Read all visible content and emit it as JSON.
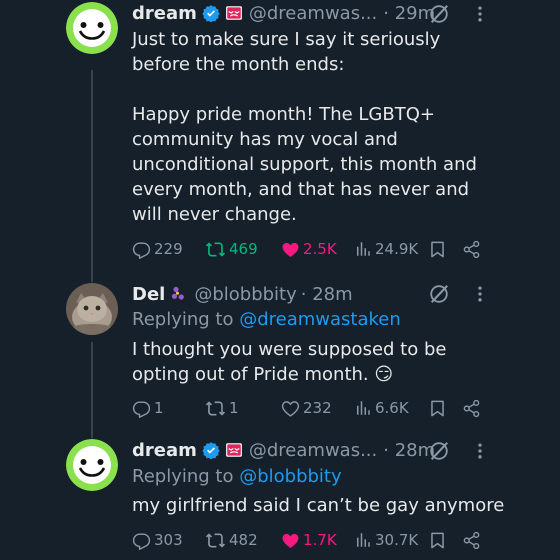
{
  "colors": {
    "background": "#15202b",
    "text": "#e7e9ea",
    "muted": "#8b98a5",
    "link": "#1d9bf0",
    "retweet": "#00ba7c",
    "like": "#f91880",
    "avatar_green": "#8be04e"
  },
  "tweets": [
    {
      "name": "dream",
      "handle": "@dreamwas...",
      "time": "· 29m",
      "text": "Just to make sure I say it seriously before the month ends:\n\nHappy pride month! The LGBTQ+ community has my vocal and unconditional support, this month and every month, and that has never and will never change.",
      "replies": "229",
      "retweets": "469",
      "likes": "2.5K",
      "views": "24.9K"
    },
    {
      "name": "Del",
      "handle": "@blobbbity",
      "time": "· 28m",
      "replying_prefix": "Replying to ",
      "replying_mention": "@dreamwastaken",
      "text": "I thought you were supposed to be opting out of Pride month. 😏",
      "replies": "1",
      "retweets": "1",
      "likes": "232",
      "views": "6.6K"
    },
    {
      "name": "dream",
      "handle": "@dreamwas...",
      "time": "· 28m",
      "replying_prefix": "Replying to ",
      "replying_mention": "@blobbbity",
      "text": "my girlfriend said I can’t be gay anymore",
      "replies": "303",
      "retweets": "482",
      "likes": "1.7K",
      "views": "30.7K"
    }
  ]
}
